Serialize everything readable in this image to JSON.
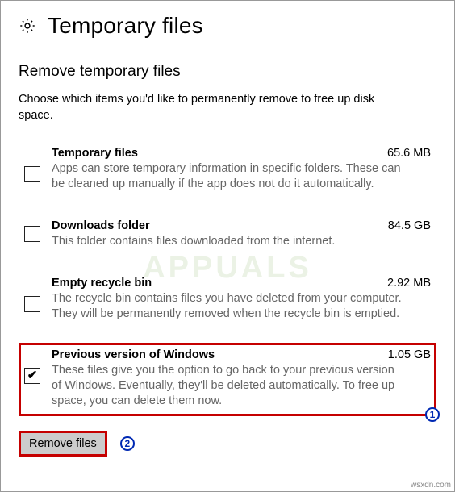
{
  "header": {
    "title": "Temporary files"
  },
  "section": {
    "title": "Remove temporary files",
    "intro": "Choose which items you'd like to permanently remove to free up disk space."
  },
  "items": [
    {
      "checked": false,
      "title": "Temporary files",
      "size": "65.6 MB",
      "desc": "Apps can store temporary information in specific folders. These can be cleaned up manually if the app does not do it automatically."
    },
    {
      "checked": false,
      "title": "Downloads folder",
      "size": "84.5 GB",
      "desc": "This folder contains files downloaded from the internet."
    },
    {
      "checked": false,
      "title": "Empty recycle bin",
      "size": "2.92 MB",
      "desc": "The recycle bin contains files you have deleted from your computer. They will be permanently removed when the recycle bin is emptied."
    },
    {
      "checked": true,
      "highlighted": true,
      "title": "Previous version of Windows",
      "size": "1.05 GB",
      "desc": "These files give you the option to go back to your previous version of Windows. Eventually, they'll be deleted automatically. To free up space, you can delete them now."
    }
  ],
  "actions": {
    "remove_label": "Remove files"
  },
  "annotations": {
    "one": "1",
    "two": "2"
  },
  "watermark": "APPUALS",
  "credit": "wsxdn.com"
}
